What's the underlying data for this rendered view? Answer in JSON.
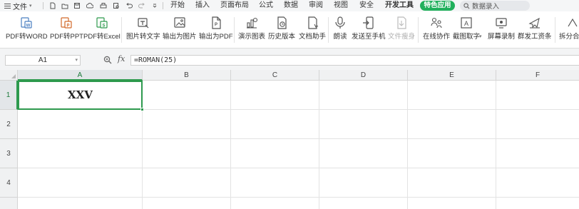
{
  "menubar": {
    "file_label": "文件",
    "quick_icons": [
      "new-doc-icon",
      "open-folder-icon",
      "save-icon",
      "cloud-icon",
      "print-icon",
      "print-preview-icon",
      "undo-icon",
      "redo-icon",
      "customize-icon"
    ],
    "menus": [
      "开始",
      "插入",
      "页面布局",
      "公式",
      "数据",
      "审阅",
      "视图",
      "安全",
      "开发工具"
    ],
    "special_app": "特色应用",
    "search_placeholder": "数据录入"
  },
  "ribbon": {
    "buttons": [
      {
        "label": "PDF转WORD",
        "icon": "pdf-to-word-icon",
        "enabled": true
      },
      {
        "label": "PDF转PPT",
        "icon": "pdf-to-ppt-icon",
        "enabled": true
      },
      {
        "label": "PDF转Excel",
        "icon": "pdf-to-excel-icon",
        "enabled": true
      },
      {
        "label": "图片转文字",
        "icon": "image-to-text-icon",
        "enabled": true
      },
      {
        "label": "输出为图片",
        "icon": "export-image-icon",
        "enabled": true
      },
      {
        "label": "输出为PDF",
        "icon": "export-pdf-icon",
        "enabled": true
      },
      {
        "label": "演示图表",
        "icon": "demo-chart-icon",
        "enabled": true
      },
      {
        "label": "历史版本",
        "icon": "history-version-icon",
        "enabled": true
      },
      {
        "label": "文档助手",
        "icon": "doc-assistant-icon",
        "enabled": true
      },
      {
        "label": "朗读",
        "icon": "microphone-icon",
        "enabled": true
      },
      {
        "label": "发送至手机",
        "icon": "send-to-phone-icon",
        "enabled": true
      },
      {
        "label": "文件瘦身",
        "icon": "file-slim-icon",
        "enabled": false
      },
      {
        "label": "在线协作",
        "icon": "online-collab-icon",
        "enabled": true
      },
      {
        "label": "截图取字",
        "icon": "screenshot-text-icon",
        "enabled": true,
        "has_dropdown": true
      },
      {
        "label": "屏幕录制",
        "icon": "screen-record-icon",
        "enabled": true
      },
      {
        "label": "群发工资条",
        "icon": "payslip-icon",
        "enabled": true
      },
      {
        "label": "拆分合并",
        "icon": "split-merge-icon",
        "enabled": true
      }
    ]
  },
  "formula_bar": {
    "name_box": "A1",
    "formula": "=ROMAN(25)"
  },
  "sheet": {
    "columns": [
      "A",
      "B",
      "C",
      "D",
      "E",
      "F"
    ],
    "rows": [
      "1",
      "2",
      "3",
      "4"
    ],
    "selected_cell": "A1",
    "cells": {
      "A1": "XXV"
    },
    "accent_color": "#2e9a4e"
  }
}
